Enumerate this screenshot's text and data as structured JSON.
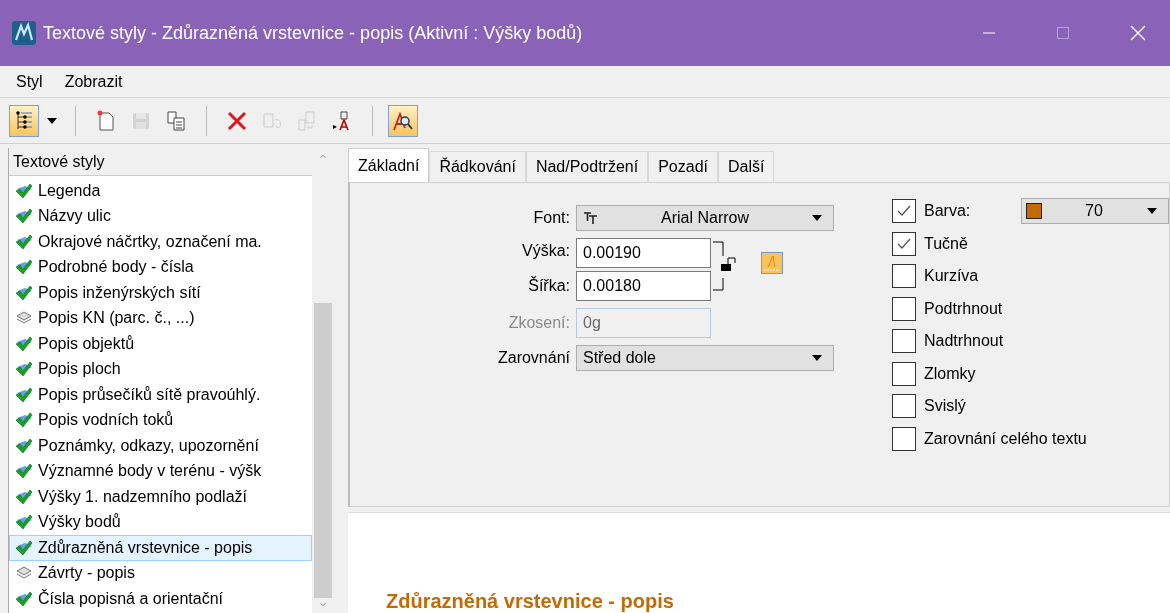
{
  "window": {
    "title": "Textové styly - Zdůrazněná vrstevnice - popis (Aktivní : Výšky bodů)"
  },
  "menu": [
    "Styl",
    "Zobrazit"
  ],
  "toolbar": [
    [
      {
        "kind": "tree",
        "on": true,
        "disabled": false
      },
      {
        "kind": "dropdown",
        "on": false,
        "disabled": false
      }
    ],
    [
      {
        "kind": "new",
        "on": false,
        "disabled": false
      },
      {
        "kind": "save",
        "on": false,
        "disabled": true
      },
      {
        "kind": "copy",
        "on": false,
        "disabled": false
      }
    ],
    [
      {
        "kind": "delete",
        "on": false,
        "disabled": false
      },
      {
        "kind": "export",
        "on": false,
        "disabled": true
      },
      {
        "kind": "import",
        "on": false,
        "disabled": true
      },
      {
        "kind": "apply",
        "on": false,
        "disabled": false
      }
    ],
    [
      {
        "kind": "preview",
        "on": true,
        "disabled": false
      }
    ]
  ],
  "sidebar": {
    "header": "Textové styly",
    "items": [
      {
        "label": "Legenda",
        "kind": "used",
        "selected": false
      },
      {
        "label": "Názvy ulic",
        "kind": "used",
        "selected": false
      },
      {
        "label": "Okrajové náčrtky, označení ma.",
        "kind": "used",
        "selected": false
      },
      {
        "label": "Podrobné body - čísla",
        "kind": "used",
        "selected": false
      },
      {
        "label": "Popis inženýrských sítí",
        "kind": "used",
        "selected": false
      },
      {
        "label": "Popis KN (parc. č., ...)",
        "kind": "unused",
        "selected": false
      },
      {
        "label": "Popis objektů",
        "kind": "used",
        "selected": false
      },
      {
        "label": "Popis ploch",
        "kind": "used",
        "selected": false
      },
      {
        "label": "Popis průsečíků sítě pravoúhlý.",
        "kind": "used",
        "selected": false
      },
      {
        "label": "Popis vodních toků",
        "kind": "used",
        "selected": false
      },
      {
        "label": "Poznámky, odkazy, upozornění",
        "kind": "used",
        "selected": false
      },
      {
        "label": "Významné body v terénu - výšk",
        "kind": "used",
        "selected": false
      },
      {
        "label": "Výšky 1. nadzemního podlaží",
        "kind": "used",
        "selected": false
      },
      {
        "label": "Výšky bodů",
        "kind": "used",
        "selected": false
      },
      {
        "label": "Zdůrazněná vrstevnice - popis",
        "kind": "used",
        "selected": true
      },
      {
        "label": "Závrty - popis",
        "kind": "unused",
        "selected": false
      },
      {
        "label": "Čísla popisná a orientační",
        "kind": "used",
        "selected": false
      }
    ]
  },
  "tabs": [
    {
      "label": "Základní",
      "selected": true
    },
    {
      "label": "Řádkování",
      "selected": false
    },
    {
      "label": "Nad/Podtržení",
      "selected": false
    },
    {
      "label": "Pozadí",
      "selected": false
    },
    {
      "label": "Další",
      "selected": false
    }
  ],
  "form": {
    "font": {
      "label": "Font:",
      "value": "Arial Narrow"
    },
    "height": {
      "label": "Výška:",
      "value": "0.00190",
      "disabled": false
    },
    "width": {
      "label": "Šířka:",
      "value": "0.00180",
      "disabled": false
    },
    "slant": {
      "label": "Zkosení:",
      "value": "0g",
      "disabled": true
    },
    "align": {
      "label": "Zarovnání",
      "value": "Střed dole"
    },
    "locked": false
  },
  "options": [
    {
      "label": "Barva:",
      "checked": true,
      "kind": "color",
      "color": "#c46a00",
      "value": "70"
    },
    {
      "label": "Tučně",
      "checked": true,
      "kind": "check"
    },
    {
      "label": "Kurzíva",
      "checked": false,
      "kind": "check"
    },
    {
      "label": "Podtrhnout",
      "checked": false,
      "kind": "check"
    },
    {
      "label": "Nadtrhnout",
      "checked": false,
      "kind": "check"
    },
    {
      "label": "Zlomky",
      "checked": false,
      "kind": "check"
    },
    {
      "label": "Svislý",
      "checked": false,
      "kind": "check"
    },
    {
      "label": "Zarovnání celého textu",
      "checked": false,
      "kind": "check"
    }
  ],
  "preview": {
    "text": "Zdůrazněná vrstevnice - popis"
  }
}
